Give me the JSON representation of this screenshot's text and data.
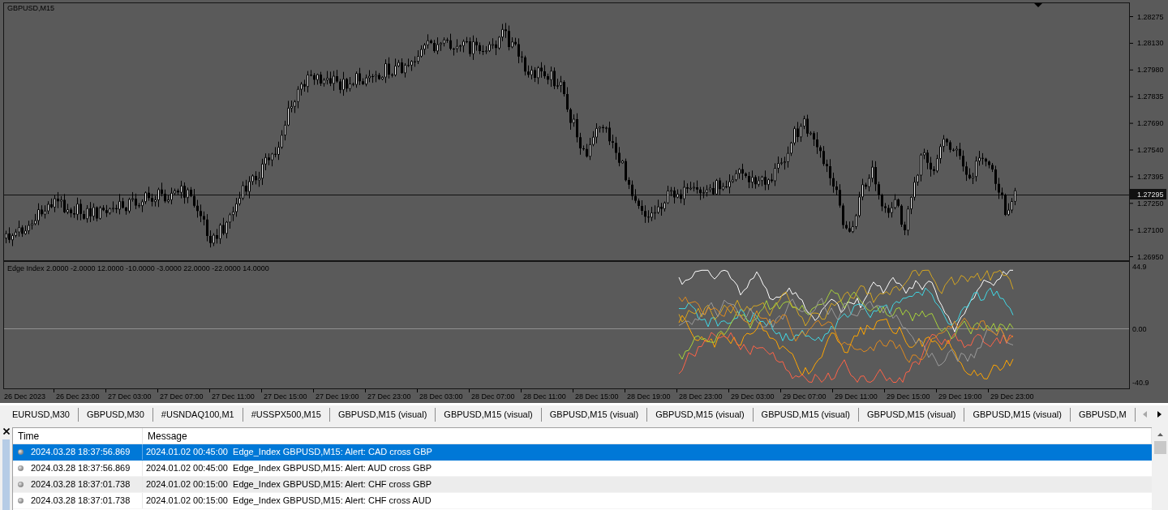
{
  "chart": {
    "title": "GBPUSD,M15",
    "price_axis": {
      "labels": [
        "1.28275",
        "1.28130",
        "1.27980",
        "1.27835",
        "1.27690",
        "1.27540",
        "1.27395",
        "1.27250",
        "1.27100",
        "1.26950"
      ],
      "current_price": "1.27295"
    },
    "indicator": {
      "label": "Edge Index 2.0000 -2.0000 12.0000 -10.0000 -3.0000 22.0000 -22.0000 14.0000",
      "axis_labels": [
        "44.9",
        "0.00",
        "-40.9"
      ]
    },
    "time_axis": [
      "26 Dec 2023",
      "26 Dec 23:00",
      "27 Dec 03:00",
      "27 Dec 07:00",
      "27 Dec 11:00",
      "27 Dec 15:00",
      "27 Dec 19:00",
      "27 Dec 23:00",
      "28 Dec 03:00",
      "28 Dec 07:00",
      "28 Dec 11:00",
      "28 Dec 15:00",
      "28 Dec 19:00",
      "28 Dec 23:00",
      "29 Dec 03:00",
      "29 Dec 07:00",
      "29 Dec 11:00",
      "29 Dec 15:00",
      "29 Dec 19:00",
      "29 Dec 23:00"
    ]
  },
  "tabs": [
    {
      "label": "EURUSD,M30",
      "selected": false
    },
    {
      "label": "GBPUSD,M30",
      "selected": false
    },
    {
      "label": "#USNDAQ100,M1",
      "selected": false
    },
    {
      "label": "#USSPX500,M15",
      "selected": false
    },
    {
      "label": "GBPUSD,M15 (visual)",
      "selected": false
    },
    {
      "label": "GBPUSD,M15 (visual)",
      "selected": false
    },
    {
      "label": "GBPUSD,M15 (visual)",
      "selected": false
    },
    {
      "label": "GBPUSD,M15 (visual)",
      "selected": false
    },
    {
      "label": "GBPUSD,M15 (visual)",
      "selected": false
    },
    {
      "label": "GBPUSD,M15 (visual)",
      "selected": false
    },
    {
      "label": "GBPUSD,M15 (visual)",
      "selected": false
    },
    {
      "label": "GBPUSD,M",
      "selected": false
    }
  ],
  "tab_scroller": {
    "back_disabled": true,
    "forward_disabled": false
  },
  "journal": {
    "columns": [
      "Time",
      "Message"
    ],
    "rows": [
      {
        "time": "2024.03.28 18:37:56.869",
        "message": "2024.01.02 00:45:00  Edge_Index GBPUSD,M15: Alert: CAD cross GBP",
        "selected": true
      },
      {
        "time": "2024.03.28 18:37:56.869",
        "message": "2024.01.02 00:45:00  Edge_Index GBPUSD,M15: Alert: AUD cross GBP",
        "selected": false
      },
      {
        "time": "2024.03.28 18:37:01.738",
        "message": "2024.01.02 00:15:00  Edge_Index GBPUSD,M15: Alert: CHF cross GBP",
        "selected": false
      },
      {
        "time": "2024.03.28 18:37:01.738",
        "message": "2024.01.02 00:15:00  Edge_Index GBPUSD,M15: Alert: CHF cross AUD",
        "selected": false
      }
    ]
  }
}
